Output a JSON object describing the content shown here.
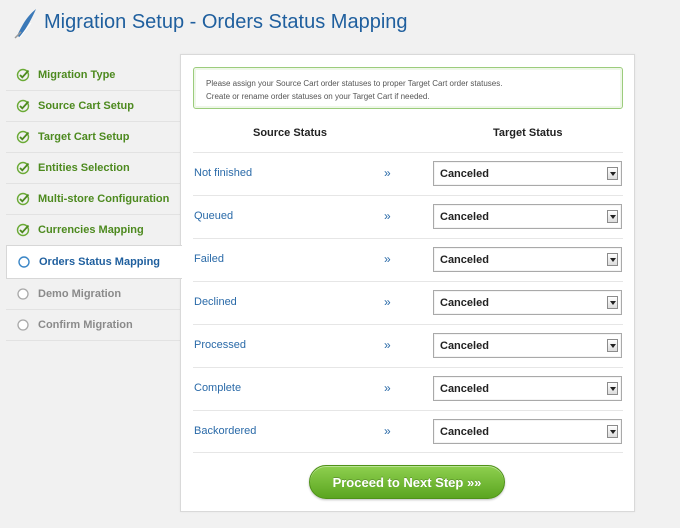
{
  "header": {
    "title": "Migration Setup - Orders Status Mapping",
    "logo_icon": "feather-arrow-icon"
  },
  "sidebar": {
    "steps": [
      {
        "label": "Migration Type",
        "state": "done",
        "icon": "check-circle-icon"
      },
      {
        "label": "Source Cart Setup",
        "state": "done",
        "icon": "check-circle-icon"
      },
      {
        "label": "Target Cart Setup",
        "state": "done",
        "icon": "check-circle-icon"
      },
      {
        "label": "Entities Selection",
        "state": "done",
        "icon": "check-circle-icon"
      },
      {
        "label": "Multi-store Configuration",
        "state": "done",
        "icon": "check-circle-icon"
      },
      {
        "label": "Currencies Mapping",
        "state": "done",
        "icon": "check-circle-icon"
      },
      {
        "label": "Orders Status Mapping",
        "state": "active",
        "icon": "circle-icon"
      },
      {
        "label": "Demo Migration",
        "state": "pending",
        "icon": "circle-icon"
      },
      {
        "label": "Confirm Migration",
        "state": "pending",
        "icon": "circle-icon"
      }
    ]
  },
  "notice": {
    "line1": "Please assign your Source Cart order statuses to proper Target Cart order statuses.",
    "line2": "Create or rename order statuses on your Target Cart if needed."
  },
  "table": {
    "source_header": "Source Status",
    "target_header": "Target Status",
    "arrow": "»",
    "rows": [
      {
        "source": "Not finished",
        "target": "Canceled"
      },
      {
        "source": "Queued",
        "target": "Canceled"
      },
      {
        "source": "Failed",
        "target": "Canceled"
      },
      {
        "source": "Declined",
        "target": "Canceled"
      },
      {
        "source": "Processed",
        "target": "Canceled"
      },
      {
        "source": "Complete",
        "target": "Canceled"
      },
      {
        "source": "Backordered",
        "target": "Canceled"
      }
    ]
  },
  "actions": {
    "proceed_label": "Proceed to Next Step »»"
  },
  "colors": {
    "title_blue": "#1f5f9e",
    "done_green": "#4d8a1f",
    "pending_gray": "#8a8a8a",
    "button_green": "#6cb52e"
  }
}
